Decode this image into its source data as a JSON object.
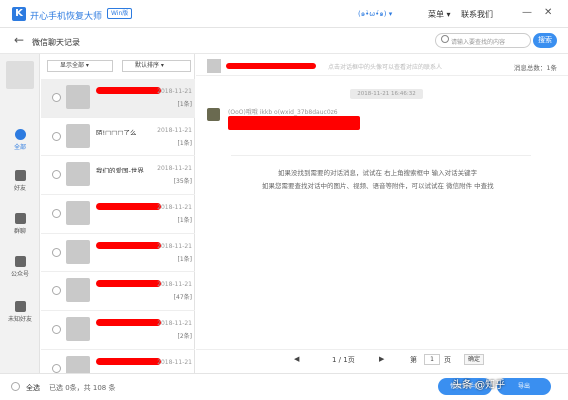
{
  "window": {
    "app_name": "开心手机恢复大师",
    "edition_badge": "Win版",
    "user_name": "(๑•̀ω•́๑)",
    "menu_label": "菜单",
    "contact_label": "联系我们",
    "minimize": "—",
    "close": "✕"
  },
  "toolbar": {
    "back_glyph": "←",
    "title": "微信聊天记录",
    "search_placeholder": "请输入要查找的内容",
    "search_button": "搜索"
  },
  "sidebar": {
    "items": [
      {
        "label": "全部",
        "icon": "grid-icon",
        "active": true
      },
      {
        "label": "好友",
        "icon": "person-icon",
        "active": false
      },
      {
        "label": "群聊",
        "icon": "group-icon",
        "active": false
      },
      {
        "label": "公众号",
        "icon": "apps-icon",
        "active": false
      },
      {
        "label": "未知好友",
        "icon": "unknown-user-icon",
        "active": false
      }
    ]
  },
  "list": {
    "filter_label": "显示全部",
    "sort_label": "默认排序",
    "rows": [
      {
        "name": "",
        "date": "2018-11-21",
        "count": "[1条]",
        "selected": true
      },
      {
        "name": "陌!□□□了么",
        "date": "2018-11-21",
        "count": "[1条]",
        "selected": false
      },
      {
        "name": "我们的爱国-世界",
        "date": "2018-11-21",
        "count": "[35条]",
        "selected": false
      },
      {
        "name": "",
        "date": "2018-11-21",
        "count": "[1条]",
        "selected": false
      },
      {
        "name": "",
        "date": "2018-11-21",
        "count": "[1条]",
        "selected": false
      },
      {
        "name": "",
        "date": "2018-11-21",
        "count": "[47条]",
        "selected": false
      },
      {
        "name": "",
        "date": "2018-11-21",
        "count": "[2条]",
        "selected": false
      },
      {
        "name": "",
        "date": "2018-11-21",
        "count": "",
        "selected": false
      }
    ]
  },
  "chat": {
    "hint": "点击对话框中的头像可以查看对应的联系人",
    "total_label": "消息总数：1条",
    "timestamp": "2018-11-21 16:46:32",
    "sender": "(OoO)哦哦 ikkb o(wxid_37b8dauc0z6",
    "tip_line1": "如果没找到需要的对话消息，试试在 右上角搜索框中 输入对话关键字",
    "tip_line2": "如果您需要查找对话中的图片、视频、语音等附件，可以试试在 微信附件 中查找"
  },
  "pager": {
    "prev_first": "◀",
    "prev": "◀",
    "current": "1 / 1页",
    "next": "▶",
    "last": "▶",
    "goto_label": "第",
    "page_value": "1",
    "page_unit": "页",
    "confirm": "确定"
  },
  "footer": {
    "select_all": "全选",
    "selected_info": "已选 0条，共 108 条",
    "recover_button": "恢复到手机",
    "export_button": "导出",
    "watermark": "头条 @知乎"
  },
  "colors": {
    "accent": "#2d7be0",
    "button": "#3a8ff0",
    "redaction": "#ff0000"
  }
}
